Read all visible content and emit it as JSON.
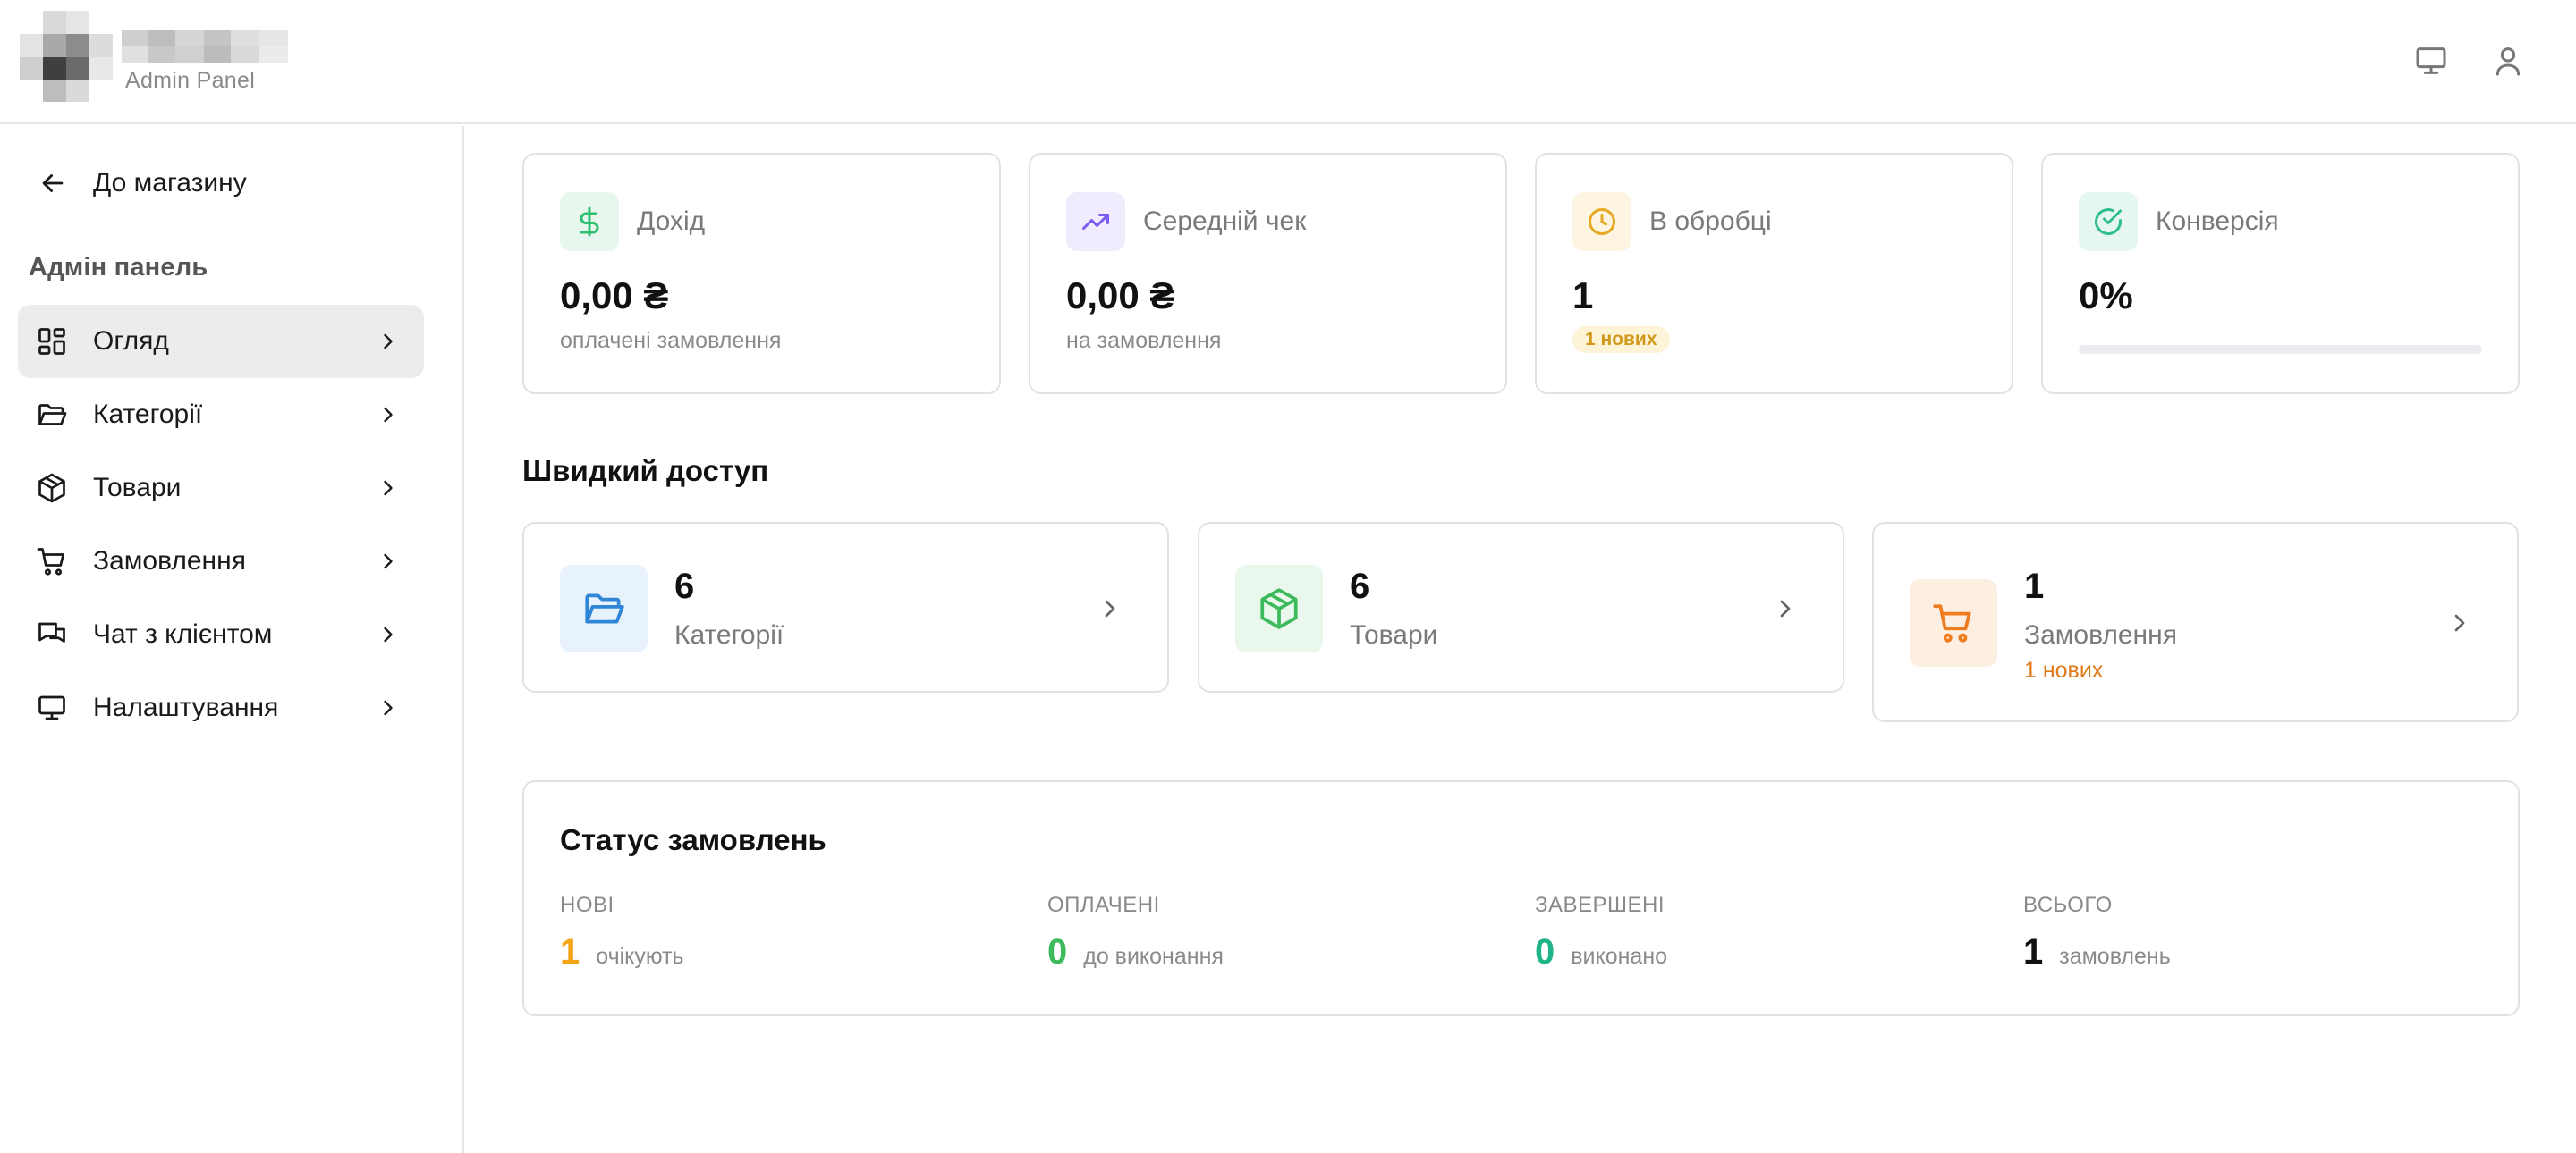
{
  "header": {
    "subtitle": "Admin Panel",
    "icons": [
      "monitor-icon",
      "user-icon"
    ]
  },
  "sidebar": {
    "back_label": "До магазину",
    "section_title": "Адмін панель",
    "items": [
      {
        "label": "Огляд",
        "icon": "layout-grid-icon",
        "active": true
      },
      {
        "label": "Категорії",
        "icon": "folder-icon",
        "active": false
      },
      {
        "label": "Товари",
        "icon": "package-icon",
        "active": false
      },
      {
        "label": "Замовлення",
        "icon": "cart-icon",
        "active": false
      },
      {
        "label": "Чат з клієнтом",
        "icon": "chat-icon",
        "active": false
      },
      {
        "label": "Налаштування",
        "icon": "monitor-icon",
        "active": false
      }
    ]
  },
  "stats": {
    "income": {
      "label": "Дохід",
      "value": "0,00 ₴",
      "sub": "оплачені замовлення",
      "color": "#2fbf71"
    },
    "avg_check": {
      "label": "Середній чек",
      "value": "0,00 ₴",
      "sub": "на замовлення",
      "color": "#7b5cf0"
    },
    "processing": {
      "label": "В обробці",
      "value": "1",
      "badge": "1 нових",
      "color": "#e5a823"
    },
    "conversion": {
      "label": "Конверсія",
      "value": "0%",
      "progress": 0,
      "color": "#2fbf8a"
    }
  },
  "quick": {
    "title": "Швидкий доступ",
    "categories": {
      "count": "6",
      "label": "Категорії",
      "color": "#2f86d6"
    },
    "products": {
      "count": "6",
      "label": "Товари",
      "color": "#3dbb5c"
    },
    "orders": {
      "count": "1",
      "label": "Замовлення",
      "sub": "1 нових",
      "color": "#ef7d1f"
    }
  },
  "status": {
    "title": "Статус замовлень",
    "cols": [
      {
        "label": "НОВІ",
        "num": "1",
        "desc": "очікують",
        "color": "#f2a516"
      },
      {
        "label": "ОПЛАЧЕНІ",
        "num": "0",
        "desc": "до виконання",
        "color": "#3dbb5c"
      },
      {
        "label": "ЗАВЕРШЕНІ",
        "num": "0",
        "desc": "виконано",
        "color": "#1fb388"
      },
      {
        "label": "ВСЬОГО",
        "num": "1",
        "desc": "замовлень",
        "color": "#111111"
      }
    ]
  }
}
